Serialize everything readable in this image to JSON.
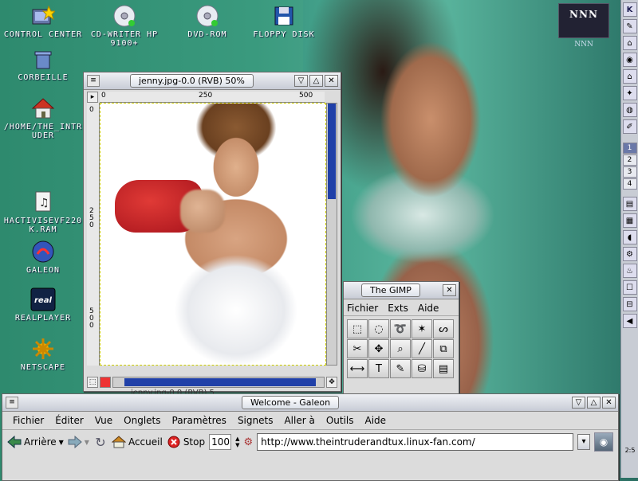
{
  "desktop": {
    "icons": [
      {
        "id": "control-center",
        "label": "Control Center",
        "icon": "control-center-icon"
      },
      {
        "id": "cd-writer",
        "label": "CD-Writer HP 9100+",
        "icon": "cd-icon"
      },
      {
        "id": "dvd-rom",
        "label": "DVD-ROM",
        "icon": "dvd-icon"
      },
      {
        "id": "floppy",
        "label": "Floppy disk",
        "icon": "floppy-icon"
      },
      {
        "id": "corbeille",
        "label": "Corbeille",
        "icon": "trash-icon"
      },
      {
        "id": "home",
        "label": "/home/the_intruder",
        "icon": "home-icon"
      },
      {
        "id": "hactivis",
        "label": "HactivisEvf220k.ram",
        "icon": "audio-file-icon"
      },
      {
        "id": "galeon",
        "label": "Galeon",
        "icon": "galeon-icon"
      },
      {
        "id": "realplayer",
        "label": "RealPlayer",
        "icon": "realplayer-icon"
      },
      {
        "id": "netscape",
        "label": "Netscape",
        "icon": "netscape-icon"
      }
    ],
    "logo_text": "NNN",
    "logo_sub": "NNN"
  },
  "gimp_image_window": {
    "title": "jenny.jpg-0.0 (RVB) 50%",
    "ruler_h_ticks": [
      "0",
      "250",
      "500"
    ],
    "ruler_v_ticks": [
      "0",
      "250",
      "500"
    ],
    "status_text": "jenny.jpg-0.0 (RVB) 5"
  },
  "gimp_toolbox": {
    "title": "The GIMP",
    "menu": [
      "Fichier",
      "Exts",
      "Aide"
    ],
    "tools": [
      {
        "name": "rect-select-icon",
        "glyph": "⬚"
      },
      {
        "name": "ellipse-select-icon",
        "glyph": "◌"
      },
      {
        "name": "lasso-icon",
        "glyph": "➰"
      },
      {
        "name": "magic-wand-icon",
        "glyph": "✶"
      },
      {
        "name": "bezier-icon",
        "glyph": "ᔕ"
      },
      {
        "name": "scissors-icon",
        "glyph": "✂"
      },
      {
        "name": "move-icon",
        "glyph": "✥"
      },
      {
        "name": "magnify-icon",
        "glyph": "⌕"
      },
      {
        "name": "brush-icon",
        "glyph": "╱"
      },
      {
        "name": "crop-icon",
        "glyph": "⧉"
      },
      {
        "name": "flip-icon",
        "glyph": "⟷"
      },
      {
        "name": "text-icon",
        "glyph": "T"
      },
      {
        "name": "color-picker-icon",
        "glyph": "✎"
      },
      {
        "name": "bucket-fill-icon",
        "glyph": "⛁"
      },
      {
        "name": "gradient-icon",
        "glyph": "▤"
      }
    ]
  },
  "galeon": {
    "title": "Welcome - Galeon",
    "menu": [
      "Fichier",
      "Éditer",
      "Vue",
      "Onglets",
      "Paramètres",
      "Signets",
      "Aller à",
      "Outils",
      "Aide"
    ],
    "toolbar": {
      "back_label": "Arrière",
      "home_label": "Accueil",
      "stop_label": "Stop",
      "zoom_value": "100",
      "url_value": "http://www.theintruderandtux.linux-fan.com/"
    }
  },
  "panel": {
    "workspaces": [
      "1",
      "2",
      "3",
      "4"
    ],
    "clock": "2:5"
  }
}
